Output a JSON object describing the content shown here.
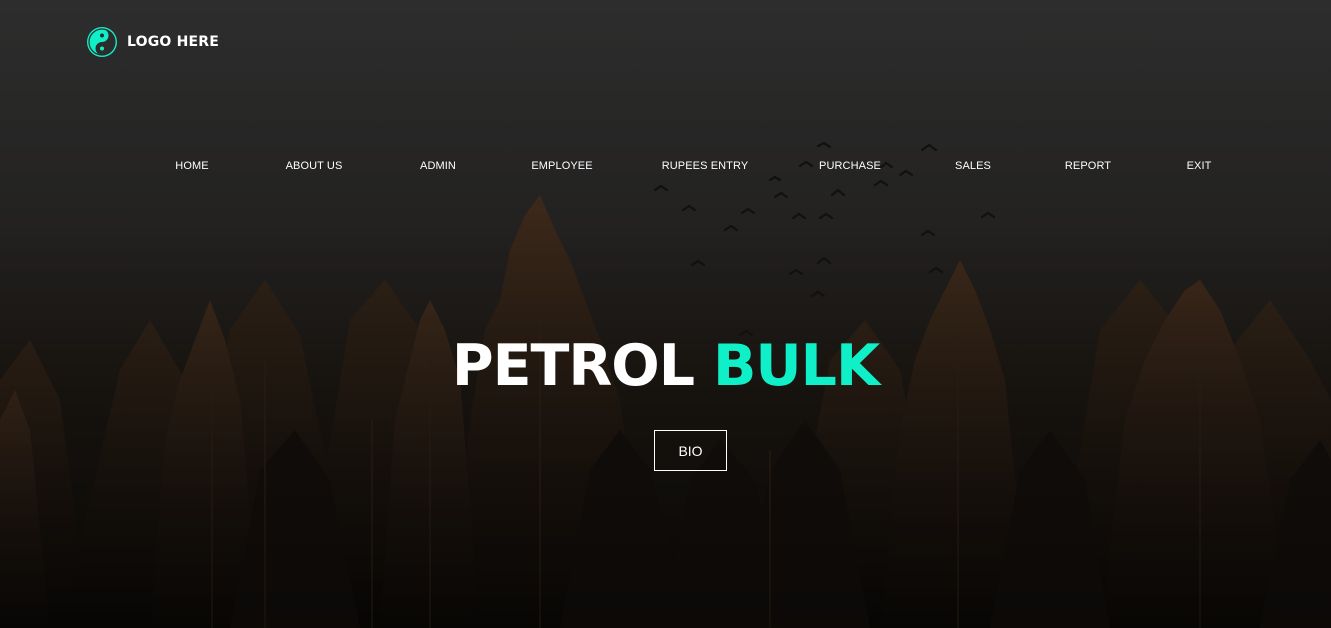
{
  "logo": {
    "text": "LOGO HERE",
    "icon": "yin-yang-icon"
  },
  "nav": {
    "items": [
      {
        "label": "HOME"
      },
      {
        "label": "ABOUT US"
      },
      {
        "label": "ADMIN"
      },
      {
        "label": "EMPLOYEE"
      },
      {
        "label": "RUPEES ENTRY"
      },
      {
        "label": "PURCHASE"
      },
      {
        "label": "SALES"
      },
      {
        "label": "REPORT"
      },
      {
        "label": "EXIT"
      }
    ]
  },
  "hero": {
    "title_white": "PETROL",
    "title_accent": "BULK",
    "button_label": "BIO",
    "background": "forest-with-birds-image"
  },
  "colors": {
    "accent": "#0ff0c8",
    "text": "#ffffff",
    "background": "#2c2c2c"
  }
}
